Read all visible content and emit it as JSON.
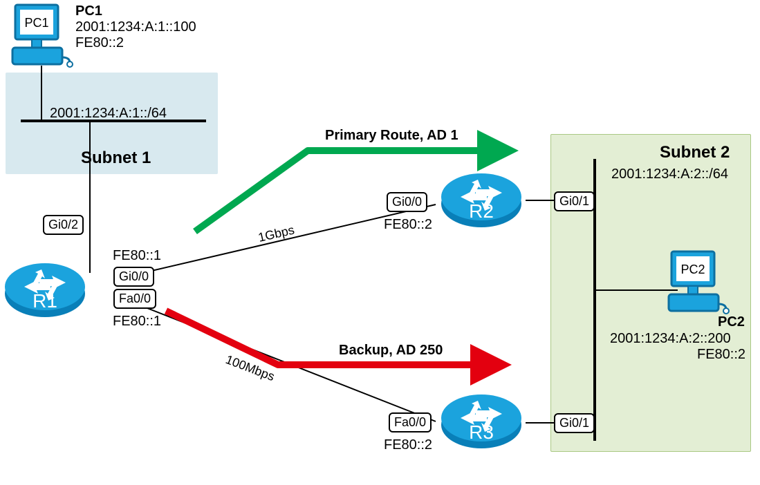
{
  "devices": {
    "pc1": {
      "small_label": "PC1",
      "title": "PC1",
      "ipv6_global": "2001:1234:A:1::100",
      "ipv6_ll": "FE80::2"
    },
    "pc2": {
      "small_label": "PC2",
      "title": "PC2",
      "ipv6_global": "2001:1234:A:2::200",
      "ipv6_ll": "FE80::2"
    },
    "r1": {
      "label": "R1"
    },
    "r2": {
      "label": "R2"
    },
    "r3": {
      "label": "R3"
    }
  },
  "subnets": {
    "s1": {
      "title": "Subnet 1",
      "prefix": "2001:1234:A:1::/64"
    },
    "s2": {
      "title": "Subnet 2",
      "prefix": "2001:1234:A:2::/64"
    }
  },
  "interfaces": {
    "r1_gi02": "Gi0/2",
    "r1_gi00": "Gi0/0",
    "r1_fa00": "Fa0/0",
    "r1_gi00_ll": "FE80::1",
    "r1_fa00_ll": "FE80::1",
    "r2_gi00": "Gi0/0",
    "r2_gi00_ll": "FE80::2",
    "r2_gi01": "Gi0/1",
    "r3_fa00": "Fa0/0",
    "r3_fa00_ll": "FE80::2",
    "r3_gi01": "Gi0/1"
  },
  "links": {
    "primary": {
      "speed": "1Gbps",
      "label": "Primary Route, AD 1",
      "color": "#00a850"
    },
    "backup": {
      "speed": "100Mbps",
      "label": "Backup, AD 250",
      "color": "#e3000f"
    }
  }
}
